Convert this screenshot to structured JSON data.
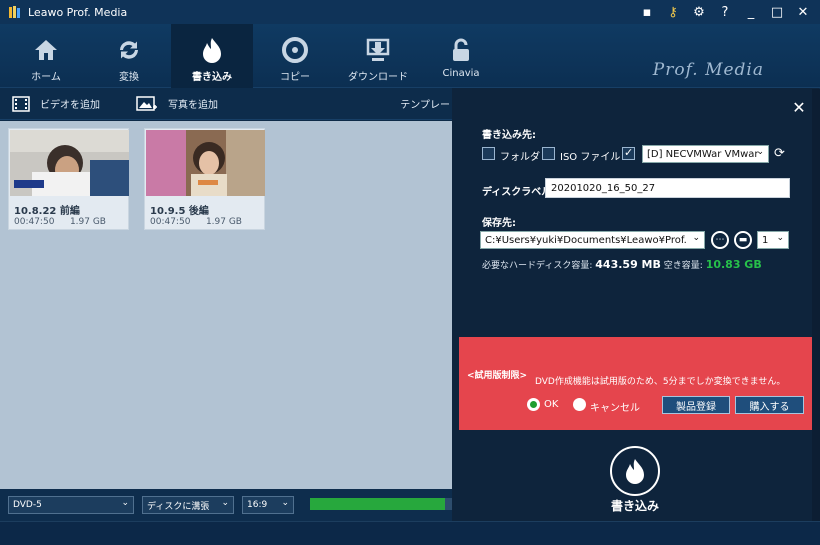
{
  "app": {
    "title": "Leawo Prof. Media",
    "brand": "Prof. Media"
  },
  "nav": [
    {
      "label": "ホーム",
      "icon": "home-icon"
    },
    {
      "label": "変換",
      "icon": "convert-icon"
    },
    {
      "label": "書き込み",
      "icon": "burn-icon",
      "active": true
    },
    {
      "label": "コピー",
      "icon": "copy-icon"
    },
    {
      "label": "ダウンロード",
      "icon": "download-icon"
    },
    {
      "label": "Cinavia",
      "icon": "cinavia-icon"
    }
  ],
  "toolbar": {
    "add_video": "ビデオを追加",
    "add_photo": "写真を追加",
    "template": "テンプレート"
  },
  "videos": [
    {
      "title": "10.8.22 前編",
      "duration": "00:47:50",
      "size": "1.97 GB"
    },
    {
      "title": "10.9.5 後編",
      "duration": "00:47:50",
      "size": "1.97 GB"
    }
  ],
  "bottom": {
    "disc_type": "DVD-5",
    "quality": "ディスクに溝張",
    "aspect": "16:9",
    "progress": 0.95
  },
  "panel": {
    "dest_label": "書き込み先:",
    "folder": "フォルダ",
    "iso": "ISO ファイル",
    "drive": "[D] NECVMWar VMwar",
    "disc_label_label": "ディスクラベル:",
    "disc_label_value": "20201020_16_50_27",
    "save_label": "保存先:",
    "save_path": "C:¥Users¥yuki¥Documents¥Leawo¥Prof. Me",
    "copies": "1",
    "req_label": "必要なハードディスク容量:",
    "req_value": "443.59 MB",
    "free_label": "空き容量:",
    "free_value": "10.83 GB"
  },
  "trial": {
    "title": "<試用版制限>",
    "message": "DVD作成機能は試用版のため、5分までしか変換できません。",
    "ok": "OK",
    "cancel": "キャンセル",
    "register": "製品登録",
    "buy": "購入する"
  },
  "burn_label": "書き込み",
  "colors": {
    "accent": "#27a83d",
    "trial_bg": "#e5454d",
    "free_space": "#27c04a"
  }
}
